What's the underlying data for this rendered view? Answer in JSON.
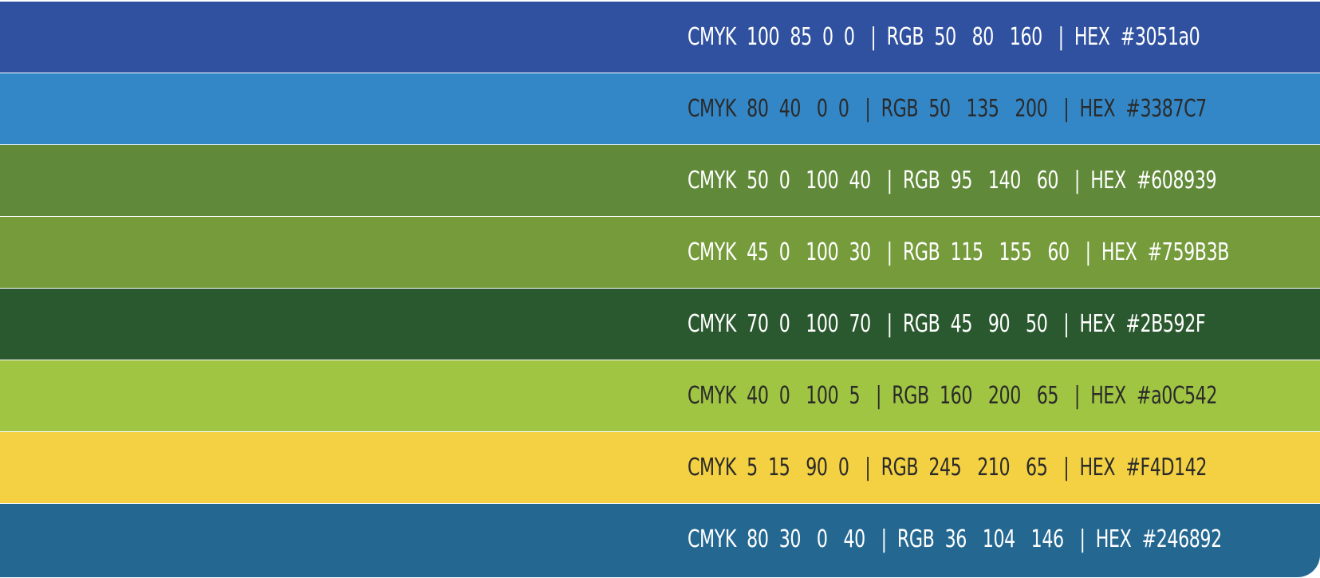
{
  "swatches": [
    {
      "label": "CMYK  100  85  0  0   |  RGB  50   80   160   |  HEX  #3051a0",
      "color": "#3051a0",
      "text_color": "#ffffff"
    },
    {
      "label": "CMYK  80  40   0  0   |  RGB  50   135   200   |  HEX  #3387C7",
      "color": "#3387c7",
      "text_color": "#2a2a2a"
    },
    {
      "label": "CMYK  50  0   100  40   |  RGB  95   140   60   |  HEX  #608939",
      "color": "#608939",
      "text_color": "#ffffff"
    },
    {
      "label": "CMYK  45  0   100  30   |  RGB  115   155   60   |  HEX  #759B3B",
      "color": "#759b3b",
      "text_color": "#ffffff"
    },
    {
      "label": "CMYK  70  0   100  70   |  RGB  45   90   50   |  HEX  #2B592F",
      "color": "#2b592f",
      "text_color": "#ffffff"
    },
    {
      "label": "CMYK  40  0   100  5   |  RGB  160   200   65   |  HEX  #a0C542",
      "color": "#a0c542",
      "text_color": "#2a2a2a"
    },
    {
      "label": "CMYK  5  15   90  0   |  RGB  245   210   65   |  HEX  #F4D142",
      "color": "#f4d142",
      "text_color": "#2a2a2a"
    },
    {
      "label": "CMYK  80  30   0   40   |  RGB  36   104   146   |  HEX  #246892",
      "color": "#246892",
      "text_color": "#ffffff"
    }
  ]
}
